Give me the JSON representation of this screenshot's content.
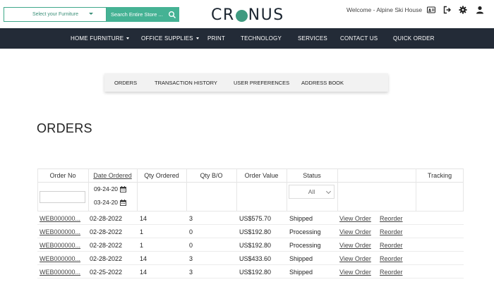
{
  "header": {
    "furniture_select": "Select your Furniture",
    "search_placeholder": "Search Entire Store ...",
    "logo": {
      "left": "CR",
      "right": "NUS"
    },
    "welcome": "Welcome - Alpine Ski House"
  },
  "nav": {
    "items": [
      {
        "label": "HOME FURNITURE",
        "dropdown": true
      },
      {
        "label": "OFFICE SUPPLIES",
        "dropdown": true
      },
      {
        "label": "PRINT",
        "dropdown": false
      },
      {
        "label": "TECHNOLOGY",
        "dropdown": false
      },
      {
        "label": "SERVICES",
        "dropdown": false
      },
      {
        "label": "CONTACT US",
        "dropdown": false
      },
      {
        "label": "QUICK ORDER",
        "dropdown": false
      }
    ]
  },
  "subtabs": [
    "ORDERS",
    "TRANSACTION HISTORY",
    "USER PREFERENCES",
    "ADDRESS BOOK"
  ],
  "page_title": "ORDERS",
  "table": {
    "headers": [
      "Order No",
      "Date Ordered",
      "Qty Ordered",
      "Qty B/O",
      "Order Value",
      "Status",
      "",
      "Tracking"
    ],
    "filters": {
      "date_from": "09-24-20",
      "date_to": "03-24-20",
      "status": "All"
    },
    "rows": [
      {
        "order_no": "WEB000000...",
        "date": "02-28-2022",
        "qty": "14",
        "bo": "3",
        "value": "US$575.70",
        "status": "Shipped",
        "view": "View Order",
        "reorder": "Reorder"
      },
      {
        "order_no": "WEB000000...",
        "date": "02-28-2022",
        "qty": "1",
        "bo": "0",
        "value": "US$192.80",
        "status": "Processing",
        "view": "View Order",
        "reorder": "Reorder"
      },
      {
        "order_no": "WEB000000...",
        "date": "02-28-2022",
        "qty": "1",
        "bo": "0",
        "value": "US$192.80",
        "status": "Processing",
        "view": "View Order",
        "reorder": "Reorder"
      },
      {
        "order_no": "WEB000000...",
        "date": "02-28-2022",
        "qty": "14",
        "bo": "3",
        "value": "US$433.60",
        "status": "Shipped",
        "view": "View Order",
        "reorder": "Reorder"
      },
      {
        "order_no": "WEB000000...",
        "date": "02-25-2022",
        "qty": "14",
        "bo": "3",
        "value": "US$192.80",
        "status": "Shipped",
        "view": "View Order",
        "reorder": "Reorder"
      }
    ]
  },
  "colors": {
    "accent": "#45b294",
    "nav_bg": "#232b37",
    "logo_globe": "#3f9a80"
  }
}
